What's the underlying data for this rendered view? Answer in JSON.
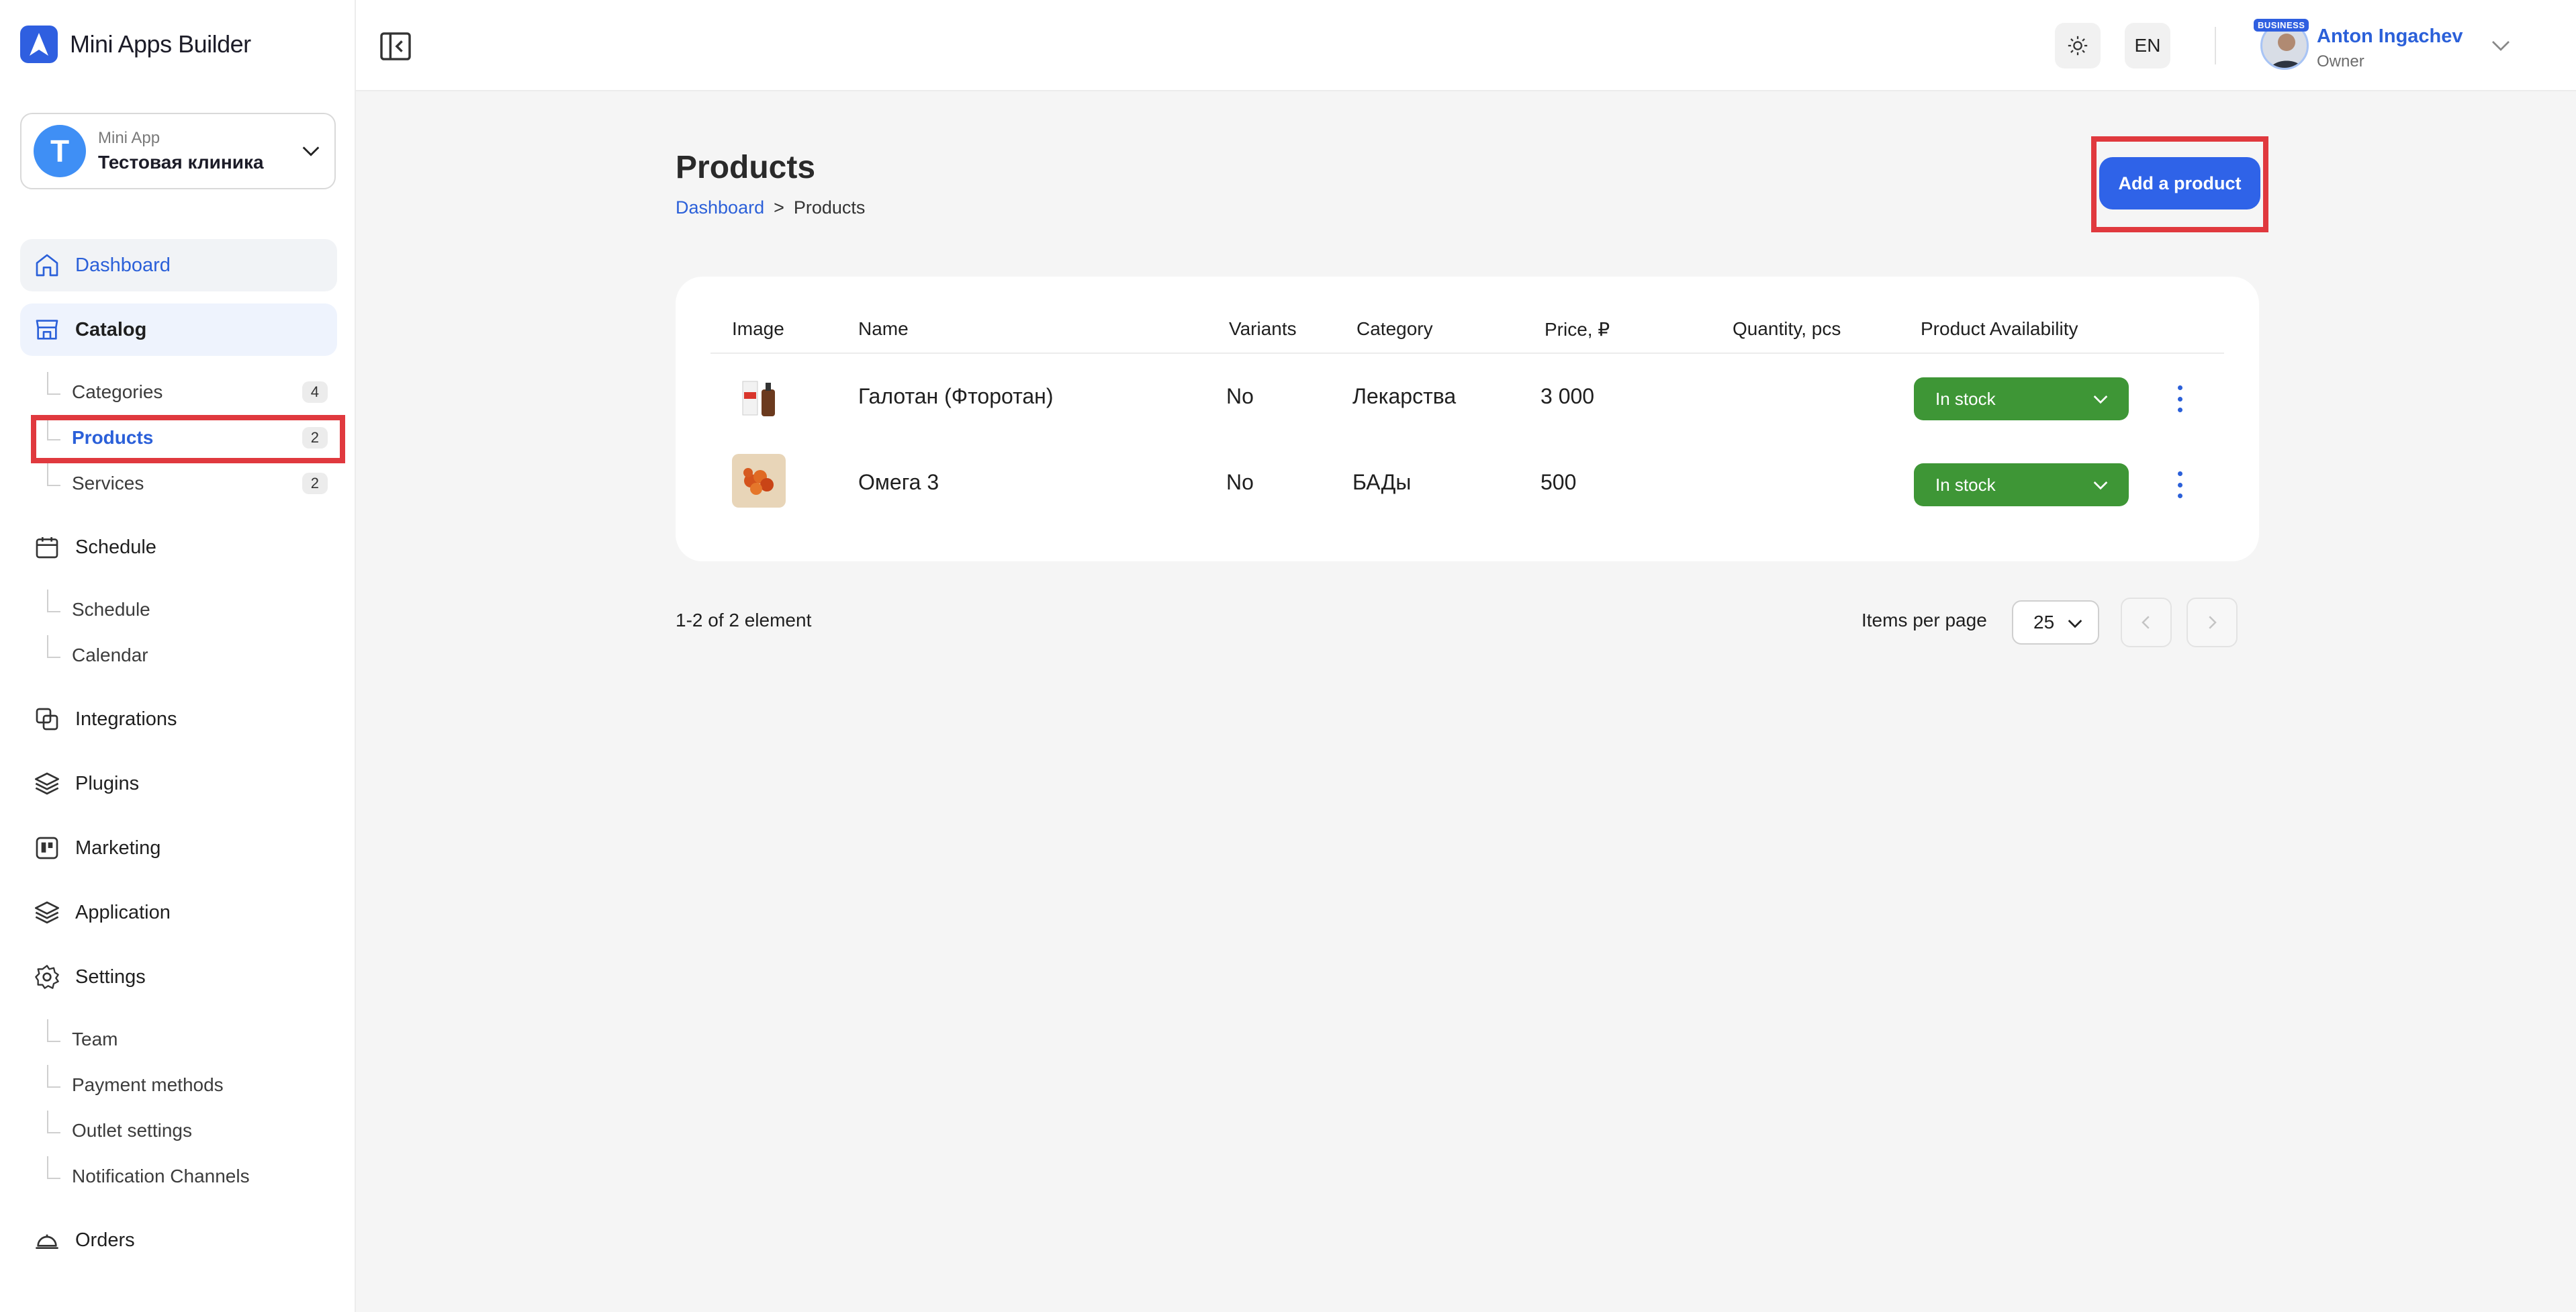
{
  "app": {
    "brand": "Mini Apps Builder"
  },
  "switcher": {
    "kind": "Mini App",
    "name": "Тестовая клиника",
    "initial": "T"
  },
  "nav": {
    "dashboard": "Dashboard",
    "catalog": "Catalog",
    "catalog_items": [
      {
        "label": "Categories",
        "count": "4"
      },
      {
        "label": "Products",
        "count": "2"
      },
      {
        "label": "Services",
        "count": "2"
      }
    ],
    "schedule": "Schedule",
    "schedule_items": [
      "Schedule",
      "Calendar"
    ],
    "integrations": "Integrations",
    "plugins": "Plugins",
    "marketing": "Marketing",
    "application": "Application",
    "settings": "Settings",
    "settings_items": [
      "Team",
      "Payment methods",
      "Outlet settings",
      "Notification Channels"
    ],
    "orders": "Orders"
  },
  "header": {
    "lang": "EN",
    "user_name": "Anton Ingachev",
    "user_role": "Owner",
    "badge": "BUSINESS"
  },
  "page": {
    "title": "Products",
    "breadcrumb_root": "Dashboard",
    "breadcrumb_sep": ">",
    "breadcrumb_current": "Products",
    "add_button": "Add a product"
  },
  "table": {
    "columns": [
      "Image",
      "Name",
      "Variants",
      "Category",
      "Price, ₽",
      "Quantity, pcs",
      "Product Availability"
    ],
    "rows": [
      {
        "name": "Галотан (Фторотан)",
        "variants": "No",
        "category": "Лекарства",
        "price": "3 000",
        "quantity": "",
        "availability": "In stock"
      },
      {
        "name": "Омега 3",
        "variants": "No",
        "category": "БАДы",
        "price": "500",
        "quantity": "",
        "availability": "In stock"
      }
    ]
  },
  "pagination": {
    "summary": "1-2 of 2 element",
    "per_page_label": "Items per page",
    "per_page_value": "25"
  },
  "colors": {
    "accent": "#2f63e8",
    "stock": "#3e9636",
    "highlight": "#e0393e"
  }
}
